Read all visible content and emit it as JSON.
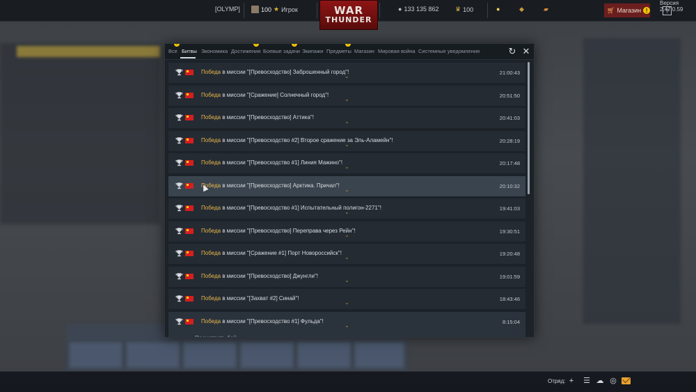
{
  "topbar": {
    "player_tag": "[OLYMP]",
    "level": "100",
    "player_name": "Игрок",
    "silver_lions": "133 135 862",
    "golden_eagles": "100",
    "shop_label": "Магазин",
    "shop_badge": "!",
    "help_label": "?",
    "version": "Версия 2.47.0.59",
    "logo_line1": "WAR",
    "logo_line2": "THUNDER"
  },
  "window": {
    "tabs": [
      {
        "label": "Все",
        "badge": "!"
      },
      {
        "label": "Битвы",
        "active": true
      },
      {
        "label": "Экономика"
      },
      {
        "label": "Достижения",
        "badge": "!"
      },
      {
        "label": "Боевые задачи",
        "badge": "!"
      },
      {
        "label": "Экипажи"
      },
      {
        "label": "Предметы",
        "badge": "!"
      },
      {
        "label": "Магазин"
      },
      {
        "label": "Мировая война"
      },
      {
        "label": "Системные уведомления"
      }
    ],
    "refresh_icon": "refresh-icon",
    "close_icon": "close-icon"
  },
  "battles": {
    "win_word": "Победа",
    "rows": [
      {
        "text": " в миссии \"[Превосходство] Заброшенный город\"!",
        "time": "21:00:43"
      },
      {
        "text": " в миссии \"[Сражение] Солнечный город\"!",
        "time": "20:51:50"
      },
      {
        "text": " в миссии \"[Превосходство] Аттика\"!",
        "time": "20:41:03"
      },
      {
        "text": " в миссии \"[Превосходство #2] Второе сражение за Эль-Аламейн\"!",
        "time": "20:28:19"
      },
      {
        "text": " в миссии \"[Превосходство #1] Линия Мажино\"!",
        "time": "20:17:48"
      },
      {
        "text": " в миссии \"[Превосходство] Арктика. Причал\"!",
        "time": "20:10:32"
      },
      {
        "text": " в миссии \"[Превосходство #1] Испытательный полигон-2271\"!",
        "time": "19:41:03"
      },
      {
        "text": " в миссии \"[Превосходство] Переправа через Рейн\"!",
        "time": "19:30:51"
      },
      {
        "text": " в миссии \"[Сражение #1] Порт Новороссийск\"!",
        "time": "19:20:48"
      },
      {
        "text": " в миссии \"[Превосходство] Джунгли\"!",
        "time": "19:01:59"
      },
      {
        "text": " в миссии \"[Захват #2] Синай\"!",
        "time": "18:43:46"
      },
      {
        "text": " в миссии \"[Превосходство #1] Фульда\"!",
        "time": "8:15:04"
      }
    ],
    "view_battle_label": "Посмотреть бой"
  },
  "bottombar": {
    "squad_label": "Отряд:"
  }
}
